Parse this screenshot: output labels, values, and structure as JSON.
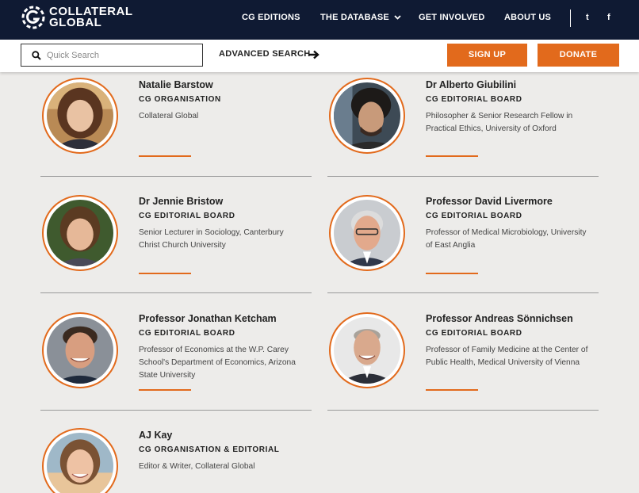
{
  "brand": {
    "line1": "COLLATERAL",
    "line2": "GLOBAL"
  },
  "nav": {
    "items": [
      "CG EDITIONS",
      "THE DATABASE",
      "GET INVOLVED",
      "ABOUT US"
    ],
    "twitter": "t",
    "facebook": "f"
  },
  "toolbar": {
    "search_placeholder": "Quick Search",
    "advanced_search": "ADVANCED SEARCH",
    "signup": "SIGN UP",
    "donate": "DONATE"
  },
  "people": [
    {
      "name": "Natalie Barstow",
      "role": "CG ORGANISATION",
      "desc": "Collateral Global"
    },
    {
      "name": "Dr Alberto Giubilini",
      "role": "CG EDITORIAL BOARD",
      "desc": "Philosopher & Senior Research Fellow in Practical Ethics, University of Oxford"
    },
    {
      "name": "Dr Jennie Bristow",
      "role": "CG EDITORIAL BOARD",
      "desc": "Senior Lecturer in Sociology, Canterbury Christ Church University"
    },
    {
      "name": "Professor David Livermore",
      "role": "CG EDITORIAL BOARD",
      "desc": "Professor of Medical Microbiology, University of East Anglia"
    },
    {
      "name": "Professor Jonathan Ketcham",
      "role": "CG EDITORIAL BOARD",
      "desc": "Professor of Economics at the W.P. Carey School's Department of Economics, Arizona State University"
    },
    {
      "name": "Professor Andreas Sönnichsen",
      "role": "CG EDITORIAL BOARD",
      "desc": "Professor of Family Medicine at the Center of Public Health, Medical University of Vienna"
    },
    {
      "name": "AJ Kay",
      "role": "CG ORGANISATION & EDITORIAL",
      "desc": "Editor & Writer, Collateral Global"
    }
  ],
  "colors": {
    "navy": "#0f1a33",
    "accent": "#e26a1c",
    "background": "#edecea"
  },
  "icons": [
    "collateral-global-logo-icon",
    "search-icon",
    "arrow-right-icon",
    "chevron-down-icon",
    "twitter-icon",
    "facebook-icon",
    "person-photo"
  ]
}
